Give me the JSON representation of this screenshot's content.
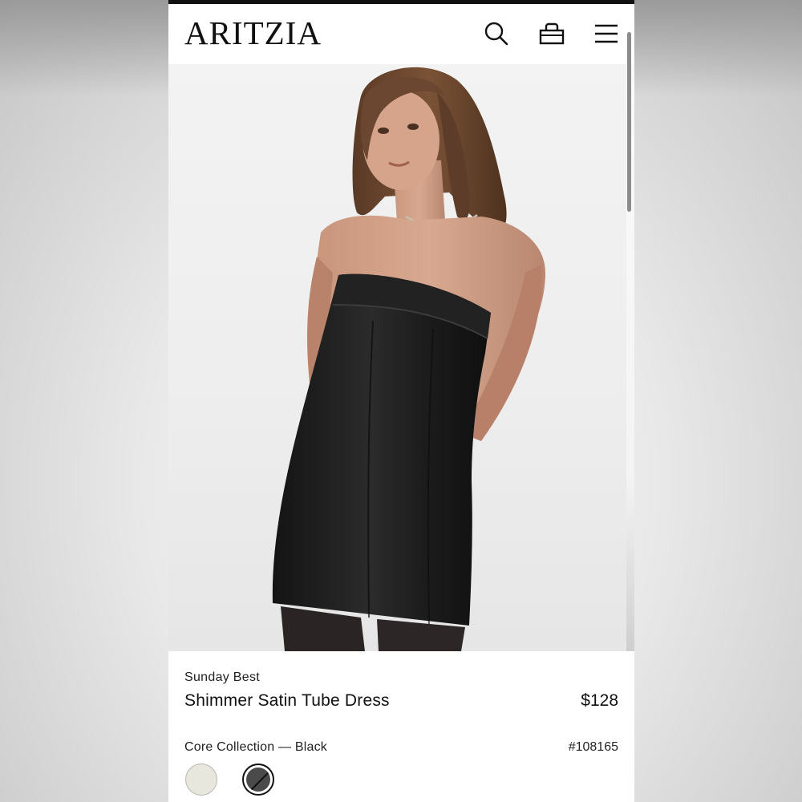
{
  "header": {
    "logo": "ARITZIA",
    "icons": [
      "search-icon",
      "bag-icon",
      "menu-icon"
    ]
  },
  "product": {
    "brand": "Sunday Best",
    "name": "Shimmer Satin Tube Dress",
    "price": "$128",
    "collection": "Core Collection — Black",
    "style_number": "#108165",
    "swatches": [
      {
        "name": "ivory",
        "color": "#e8e7de",
        "selected": false
      },
      {
        "name": "black",
        "color": "#4a4a4a",
        "selected": true
      }
    ]
  },
  "colors": {
    "background": "#ffffff",
    "text": "#111111"
  }
}
